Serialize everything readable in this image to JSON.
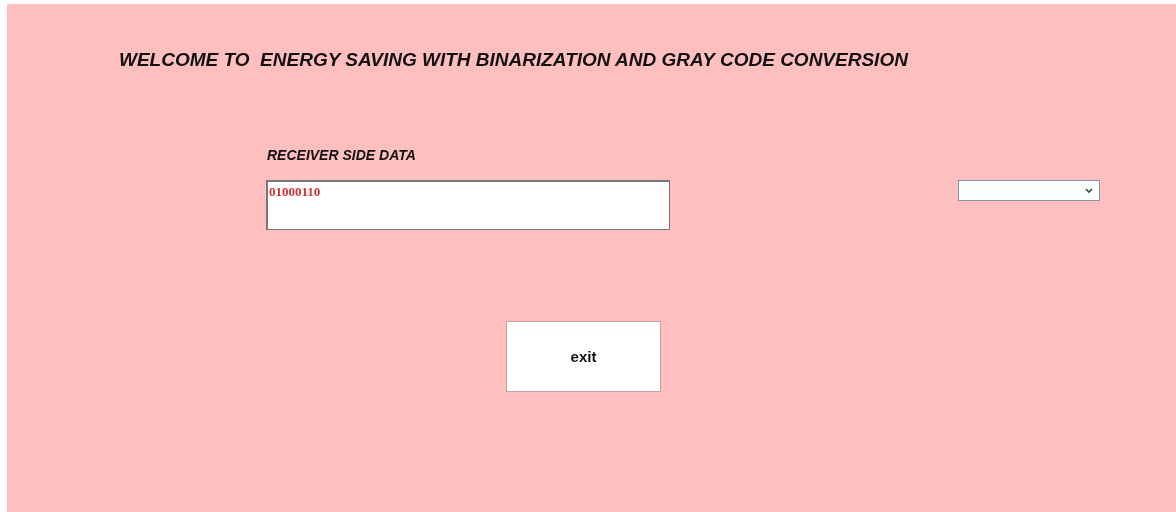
{
  "title": "WELCOME TO  ENERGY SAVING WITH BINARIZATION AND GRAY CODE CONVERSION",
  "receiver": {
    "label": "RECEIVER SIDE DATA",
    "value": "01000110"
  },
  "buttons": [
    {
      "label": "exit"
    }
  ]
}
